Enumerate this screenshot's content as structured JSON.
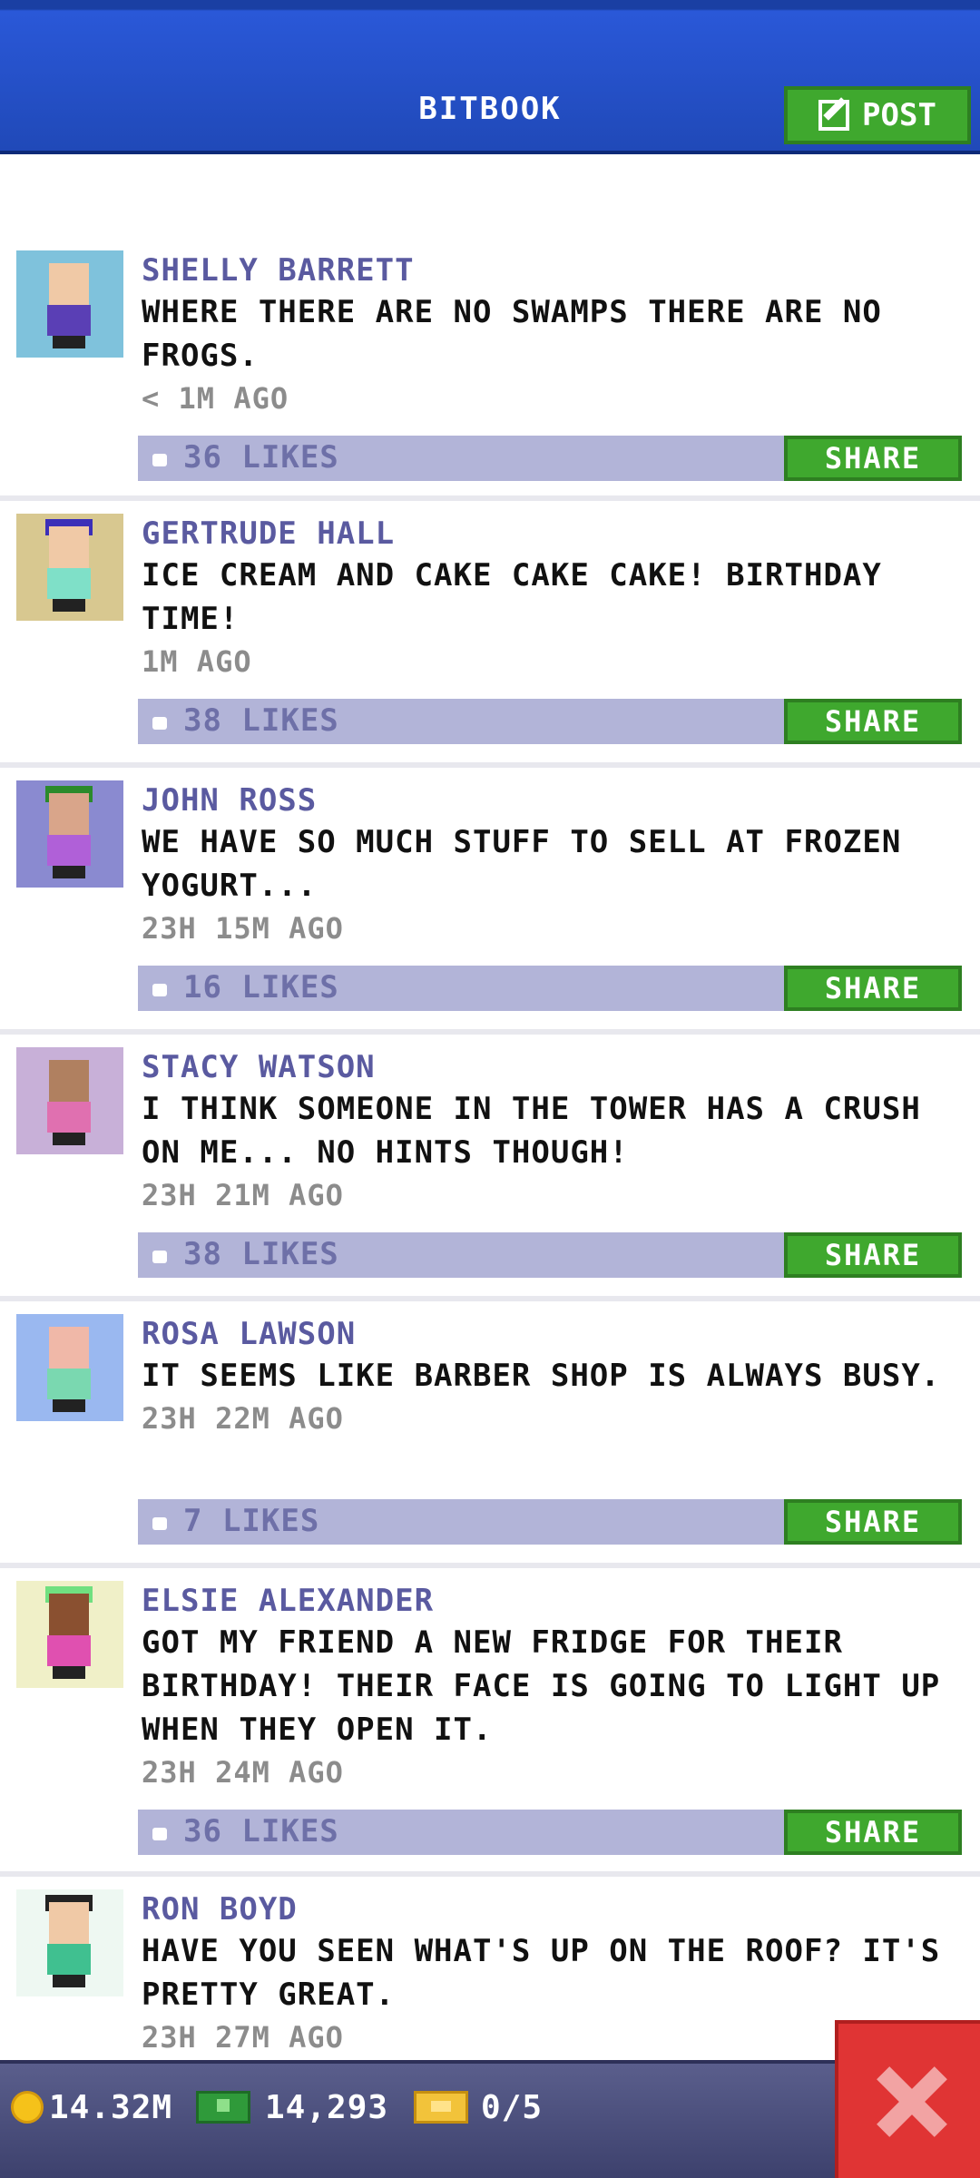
{
  "header": {
    "title": "BITBOOK",
    "post_label": "POST"
  },
  "posts": [
    {
      "name": "SHELLY BARRETT",
      "message": "WHERE THERE ARE NO SWAMPS THERE ARE NO FROGS.",
      "time": "< 1M AGO",
      "likes": "36 LIKES",
      "share": "SHARE",
      "avatar": {
        "bg": "#7fc2dc",
        "skin": "#f0c9a6",
        "shirt": "#5a3fb5",
        "hat": ""
      }
    },
    {
      "name": "GERTRUDE HALL",
      "message": "ICE CREAM AND CAKE CAKE CAKE! BIRTHDAY TIME!",
      "time": "1M AGO",
      "likes": "38 LIKES",
      "share": "SHARE",
      "avatar": {
        "bg": "#d8c890",
        "skin": "#f0c9a6",
        "shirt": "#7fe0c8",
        "hat": "#3b2fb8"
      }
    },
    {
      "name": "JOHN ROSS",
      "message": "WE HAVE SO MUCH STUFF TO SELL AT FROZEN YOGURT...",
      "time": "23H 15M AGO",
      "likes": "16 LIKES",
      "share": "SHARE",
      "avatar": {
        "bg": "#8a8ad0",
        "skin": "#d9a58a",
        "shirt": "#b060d8",
        "hat": "#2b8a2b"
      }
    },
    {
      "name": "STACY WATSON",
      "message": "I THINK SOMEONE IN THE TOWER HAS A CRUSH ON ME... NO HINTS THOUGH!",
      "time": "23H 21M AGO",
      "likes": "38 LIKES",
      "share": "SHARE",
      "avatar": {
        "bg": "#c8b0d8",
        "skin": "#b08060",
        "shirt": "#e070b0",
        "hat": ""
      }
    },
    {
      "name": "ROSA LAWSON",
      "message": "IT SEEMS LIKE BARBER SHOP IS ALWAYS BUSY.",
      "time": "23H 22M AGO",
      "likes": "7 LIKES",
      "share": "SHARE",
      "avatar": {
        "bg": "#9ab8f0",
        "skin": "#f0b8a8",
        "shirt": "#7ad8b0",
        "hat": ""
      }
    },
    {
      "name": "ELSIE ALEXANDER",
      "message": "GOT MY FRIEND A NEW FRIDGE FOR THEIR BIRTHDAY! THEIR FACE IS GOING TO LIGHT UP WHEN THEY OPEN IT.",
      "time": "23H 24M AGO",
      "likes": "36 LIKES",
      "share": "SHARE",
      "avatar": {
        "bg": "#f0f0c8",
        "skin": "#8a5030",
        "shirt": "#e050b0",
        "hat": "#70e080"
      }
    },
    {
      "name": "RON BOYD",
      "message": "HAVE YOU SEEN WHAT'S UP ON THE ROOF? IT'S PRETTY GREAT.",
      "time": "23H 27M AGO",
      "likes": "",
      "share": "",
      "avatar": {
        "bg": "#eef8f2",
        "skin": "#f0c9a6",
        "shirt": "#40c090",
        "hat": "#222222"
      }
    }
  ],
  "footer": {
    "coins": "14.32M",
    "cash": "14,293",
    "tickets": "0/5"
  }
}
